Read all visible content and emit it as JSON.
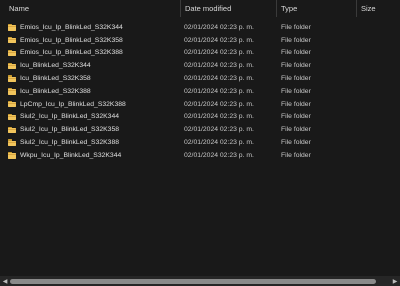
{
  "header": {
    "name": "Name",
    "date_modified": "Date modified",
    "type": "Type",
    "size": "Size",
    "sort_indicator": "^"
  },
  "files": [
    {
      "name": "Emios_Icu_Ip_BlinkLed_S32K344",
      "date": "02/01/2024 02:23 p. m.",
      "type": "File folder",
      "icon": "folder-icon"
    },
    {
      "name": "Emios_Icu_Ip_BlinkLed_S32K358",
      "date": "02/01/2024 02:23 p. m.",
      "type": "File folder",
      "icon": "folder-icon"
    },
    {
      "name": "Emios_Icu_Ip_BlinkLed_S32K388",
      "date": "02/01/2024 02:23 p. m.",
      "type": "File folder",
      "icon": "folder-icon"
    },
    {
      "name": "Icu_BlinkLed_S32K344",
      "date": "02/01/2024 02:23 p. m.",
      "type": "File folder",
      "icon": "folder-icon"
    },
    {
      "name": "Icu_BlinkLed_S32K358",
      "date": "02/01/2024 02:23 p. m.",
      "type": "File folder",
      "icon": "folder-icon"
    },
    {
      "name": "Icu_BlinkLed_S32K388",
      "date": "02/01/2024 02:23 p. m.",
      "type": "File folder",
      "icon": "folder-icon"
    },
    {
      "name": "LpCmp_Icu_Ip_BlinkLed_S32K388",
      "date": "02/01/2024 02:23 p. m.",
      "type": "File folder",
      "icon": "folder-icon"
    },
    {
      "name": "Siul2_Icu_Ip_BlinkLed_S32K344",
      "date": "02/01/2024 02:23 p. m.",
      "type": "File folder",
      "icon": "folder-icon"
    },
    {
      "name": "Siul2_Icu_Ip_BlinkLed_S32K358",
      "date": "02/01/2024 02:23 p. m.",
      "type": "File folder",
      "icon": "folder-icon"
    },
    {
      "name": "Siul2_Icu_Ip_BlinkLed_S32K388",
      "date": "02/01/2024 02:23 p. m.",
      "type": "File folder",
      "icon": "folder-icon"
    },
    {
      "name": "Wkpu_Icu_Ip_BlinkLed_S32K344",
      "date": "02/01/2024 02:23 p. m.",
      "type": "File folder",
      "icon": "folder-icon"
    }
  ],
  "scrollbar": {
    "left_arrow_icon": "scroll-left-icon",
    "right_arrow_icon": "scroll-right-icon"
  },
  "colors": {
    "background": "#191919",
    "folder": "#f2c55c",
    "text": "#e0e0e0"
  }
}
